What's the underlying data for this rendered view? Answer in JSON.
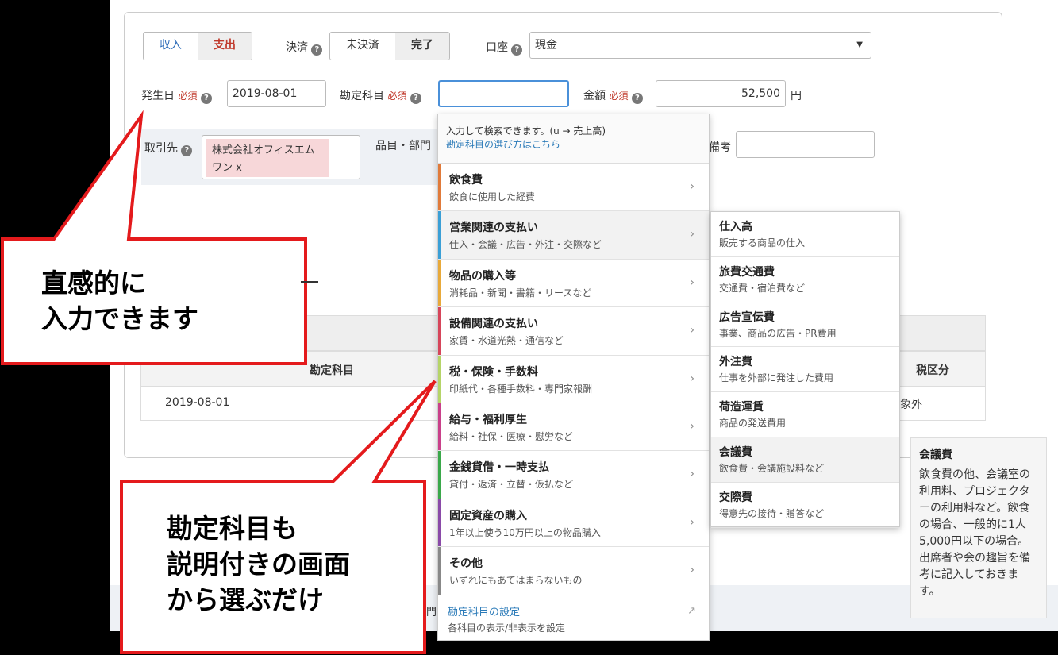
{
  "type_toggle": {
    "income": "収入",
    "expense": "支出"
  },
  "settlement": {
    "label": "決済",
    "options": [
      "未決済",
      "完了"
    ]
  },
  "account": {
    "label": "口座",
    "value": "現金"
  },
  "date": {
    "label": "発生日",
    "required": "必須",
    "value": "2019-08-01"
  },
  "account_item": {
    "label": "勘定科目",
    "required": "必須",
    "value": ""
  },
  "amount": {
    "label": "金額",
    "required": "必須",
    "value": "52,500",
    "unit": "円"
  },
  "partner": {
    "label": "取引先",
    "tag": "株式会社オフィスエムワン x"
  },
  "item_dept": {
    "label": "品目・部門"
  },
  "memo": {
    "label": "備考"
  },
  "table": {
    "headers": [
      "勘定科目",
      "税区分"
    ],
    "row": {
      "date": "2019-08-01",
      "tax": "対象外"
    }
  },
  "dropdown": {
    "hint": "入力して検索できます。(u → 売上高)",
    "help_link": "勘定科目の選び方はこちら",
    "categories": [
      {
        "title": "飲食費",
        "desc": "飲食に使用した経費",
        "color": "#e07a3a"
      },
      {
        "title": "営業関連の支払い",
        "desc": "仕入・会議・広告・外注・交際など",
        "color": "#3a9fd6"
      },
      {
        "title": "物品の購入等",
        "desc": "消耗品・新聞・書籍・リースなど",
        "color": "#e8a93a"
      },
      {
        "title": "設備関連の支払い",
        "desc": "家賃・水道光熱・通信など",
        "color": "#d6455a"
      },
      {
        "title": "税・保険・手数料",
        "desc": "印紙代・各種手数料・専門家報酬",
        "color": "#b5d468"
      },
      {
        "title": "給与・福利厚生",
        "desc": "給料・社保・医療・慰労など",
        "color": "#c9408a"
      },
      {
        "title": "金銭貸借・一時支払",
        "desc": "貸付・返済・立替・仮払など",
        "color": "#3aa84a"
      },
      {
        "title": "固定資産の購入",
        "desc": "1年以上使う10万円以上の物品購入",
        "color": "#8a4aa8"
      },
      {
        "title": "その他",
        "desc": "いずれにもあてはまらないもの",
        "color": "#888888"
      }
    ],
    "footer_link": "勘定科目の設定",
    "footer_desc": "各科目の表示/非表示を設定"
  },
  "submenu": [
    {
      "title": "仕入高",
      "desc": "販売する商品の仕入"
    },
    {
      "title": "旅費交通費",
      "desc": "交通費・宿泊費など"
    },
    {
      "title": "広告宣伝費",
      "desc": "事業、商品の広告・PR費用"
    },
    {
      "title": "外注費",
      "desc": "仕事を外部に発注した費用"
    },
    {
      "title": "荷造運賃",
      "desc": "商品の発送費用"
    },
    {
      "title": "会議費",
      "desc": "飲食費・会議施設料など"
    },
    {
      "title": "交際費",
      "desc": "得意先の接待・贈答など"
    }
  ],
  "tooltip": {
    "title": "会議費",
    "body": "飲食費の他、会議室の利用料、プロジェクターの利用料など。飲食の場合、一般的に1人5,000円以下の場合。出席者や会の趣旨を備考に記入しておきます。"
  },
  "callout1": {
    "line1": "直感的に",
    "line2": "入力できます"
  },
  "callout2": {
    "line1": "勘定科目も",
    "line2": "説明付きの画面",
    "line3": "から選ぶだけ"
  },
  "hidden_fragment": "門"
}
